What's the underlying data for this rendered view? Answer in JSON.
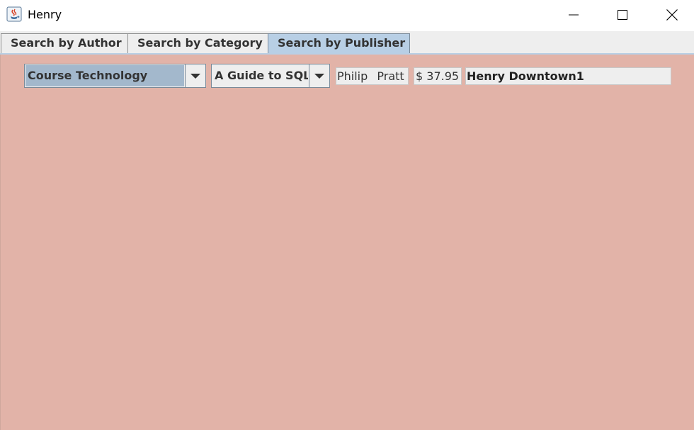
{
  "window": {
    "title": "Henry",
    "icon": "java-coffee-icon",
    "controls": [
      "minimize-icon",
      "maximize-icon",
      "close-icon"
    ]
  },
  "tabs": [
    {
      "label": "Search by Author",
      "selected": false
    },
    {
      "label": "Search by Category",
      "selected": false
    },
    {
      "label": "Search by Publisher",
      "selected": true
    }
  ],
  "publisher_panel": {
    "publisher_combo": {
      "value": "Course Technology"
    },
    "title_combo": {
      "value": "A Guide to SQL"
    },
    "author_field": "Philip Pratt",
    "price_field": "$ 37.95",
    "branch_field": "Henry Downtown1"
  },
  "colors": {
    "panel_background": "#e2b3a8",
    "selected_tab": "#b8cfe5",
    "combo_selection": "#a3b8cc"
  }
}
